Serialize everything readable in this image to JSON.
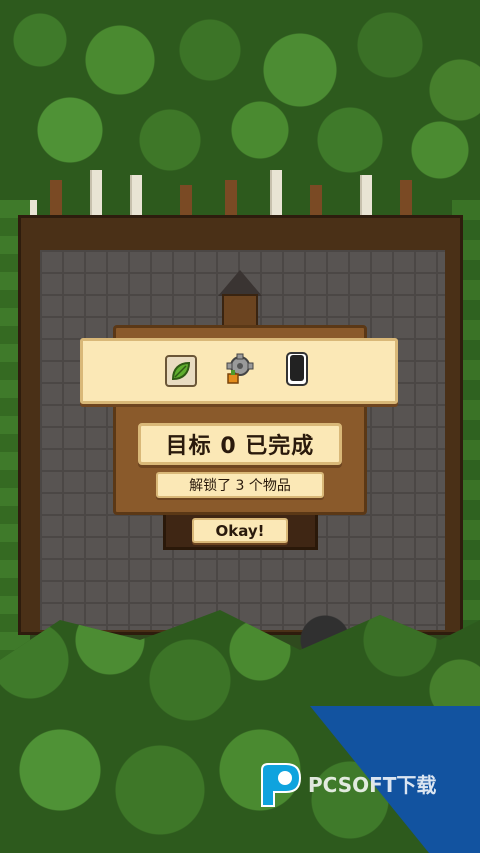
{
  "dialog": {
    "goal_text": "目标 0 已完成",
    "unlock_text": "解锁了 3 个物品",
    "okay_label": "Okay!"
  },
  "items": [
    {
      "icon": "leaf-icon"
    },
    {
      "icon": "gear-plant-icon"
    },
    {
      "icon": "canister-icon"
    }
  ],
  "watermark": {
    "text": "PCSOFT下载"
  },
  "colors": {
    "panel": "#fbe8b6",
    "panel_border": "#d9b878",
    "dialog_back": "#8a5a2b",
    "watermark_blue": "#1253a0"
  }
}
